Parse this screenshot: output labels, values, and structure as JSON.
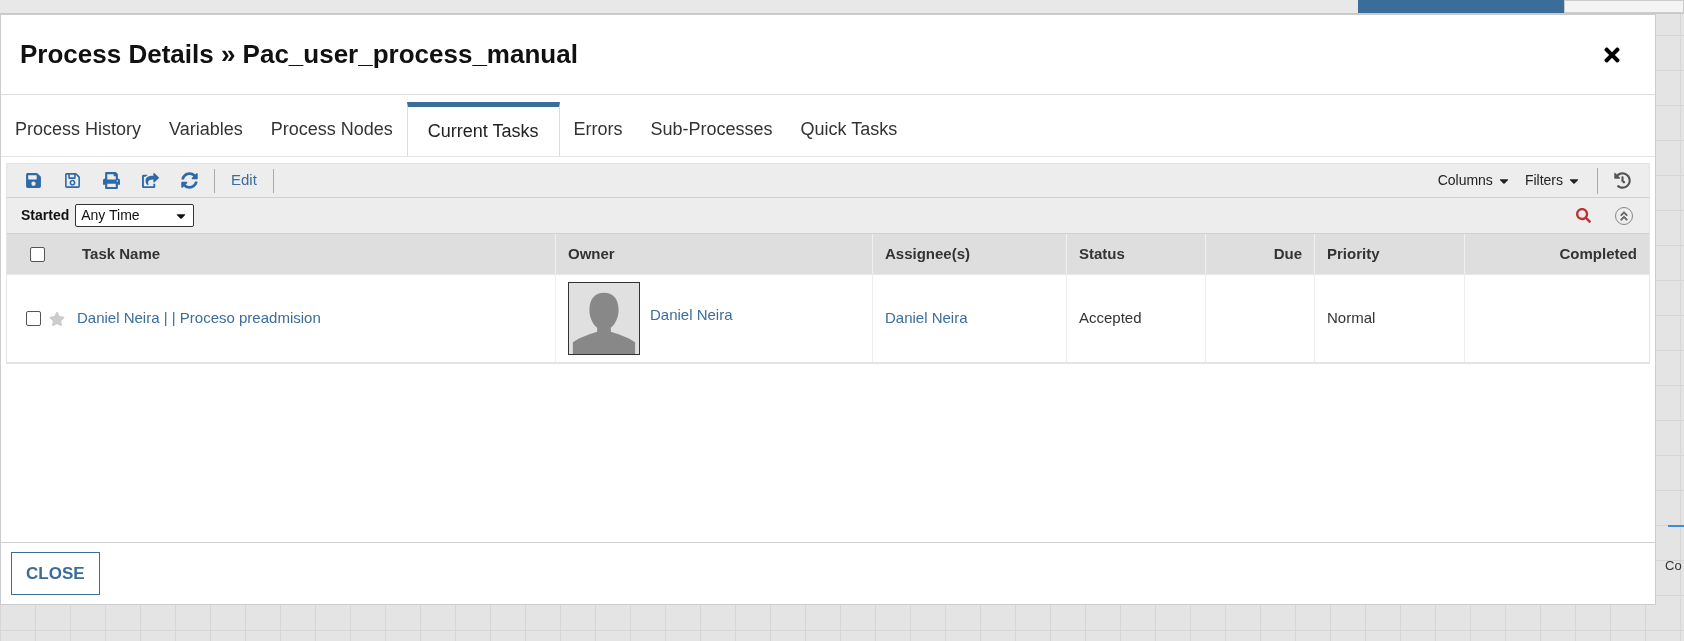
{
  "dialog": {
    "title": "Process Details » Pac_user_process_manual",
    "close_label": "CLOSE"
  },
  "tabs": [
    {
      "label": "Process History",
      "selected": false
    },
    {
      "label": "Variables",
      "selected": false
    },
    {
      "label": "Process Nodes",
      "selected": false
    },
    {
      "label": "Current Tasks",
      "selected": true
    },
    {
      "label": "Errors",
      "selected": false
    },
    {
      "label": "Sub-Processes",
      "selected": false
    },
    {
      "label": "Quick Tasks",
      "selected": false
    }
  ],
  "toolbar": {
    "edit_label": "Edit",
    "columns_label": "Columns",
    "filters_label": "Filters"
  },
  "filter": {
    "label": "Started",
    "value": "Any Time"
  },
  "table": {
    "select_all_checked": false,
    "columns": [
      "Task Name",
      "Owner",
      "Assignee(s)",
      "Status",
      "Due",
      "Priority",
      "Completed"
    ],
    "rows": [
      {
        "checked": false,
        "starred": false,
        "task_name": "Daniel Neira | | Proceso preadmision",
        "owner": "Daniel Neira",
        "assignees": "Daniel Neira",
        "status": "Accepted",
        "priority": "Normal"
      }
    ]
  },
  "background": {
    "edge_text": "Co"
  }
}
